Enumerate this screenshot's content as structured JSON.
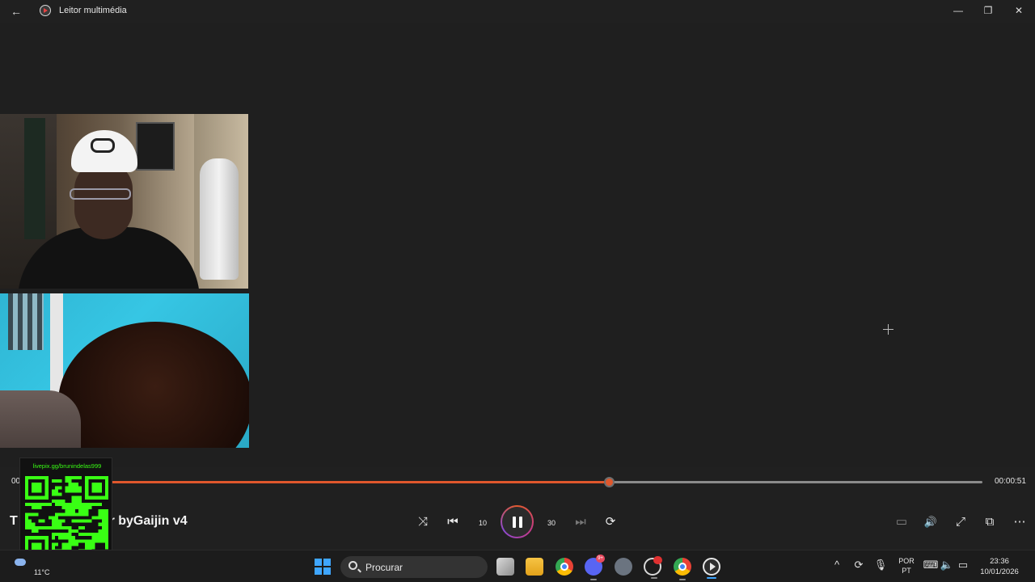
{
  "titlebar": {
    "app_title": "Leitor multimédia",
    "minimize_glyph": "—",
    "maximize_glyph": "❐",
    "close_glyph": "✕",
    "back_glyph": "←"
  },
  "player": {
    "elapsed_time": "00",
    "total_time": "00:00:51",
    "progress_fraction": 0.61,
    "track_title": "T                Mix and Master byGaijin v4",
    "controls": {
      "shuffle": "⤨",
      "previous": "⏮",
      "rewind_10": "10",
      "forward_30": "30",
      "next": "⏭",
      "repeat": "⟳",
      "miniplayer": "▭",
      "volume": "🔊",
      "fullscreen": "⤢",
      "cast": "⧉",
      "more": "⋯"
    }
  },
  "overlay": {
    "livepix_url": "livepix.gg/brunindelas999"
  },
  "taskbar": {
    "weather_temp": "11°C",
    "search_placeholder": "Procurar",
    "discord_badge": "9+",
    "lang_line1": "POR",
    "lang_line2": "PT",
    "time": "23:36",
    "date": "10/01/2026",
    "tray_chevron": "^",
    "accent_color": "#3fa6ff"
  },
  "colors": {
    "progress": "#e0572c",
    "background": "#202020"
  }
}
